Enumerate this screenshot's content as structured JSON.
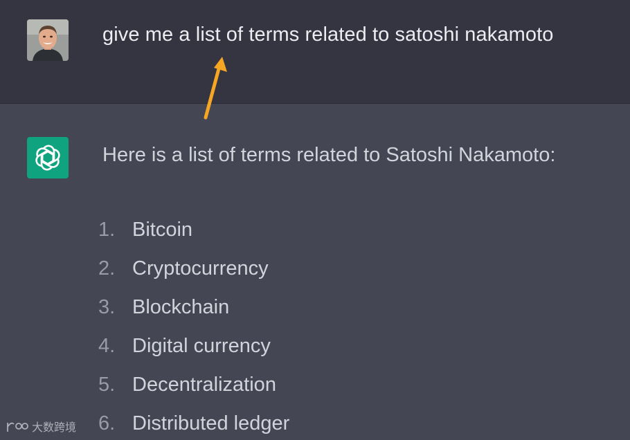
{
  "user_message": {
    "text": "give me a list of terms related to satoshi nakamoto",
    "avatar_icon": "user-avatar-photo"
  },
  "assistant_message": {
    "avatar_icon": "openai-logo-icon",
    "intro": "Here is a list of terms related to Satoshi Nakamoto:",
    "items": [
      {
        "num": "1.",
        "text": "Bitcoin"
      },
      {
        "num": "2.",
        "text": "Cryptocurrency"
      },
      {
        "num": "3.",
        "text": "Blockchain"
      },
      {
        "num": "4.",
        "text": "Digital currency"
      },
      {
        "num": "5.",
        "text": "Decentralization"
      },
      {
        "num": "6.",
        "text": "Distributed ledger"
      }
    ]
  },
  "annotation": {
    "arrow_icon": "annotation-arrow",
    "color": "#f5a623"
  },
  "watermark": {
    "text": "大数跨境"
  },
  "colors": {
    "user_bg": "#343541",
    "assistant_bg": "#444654",
    "logo_bg": "#10a37f"
  }
}
